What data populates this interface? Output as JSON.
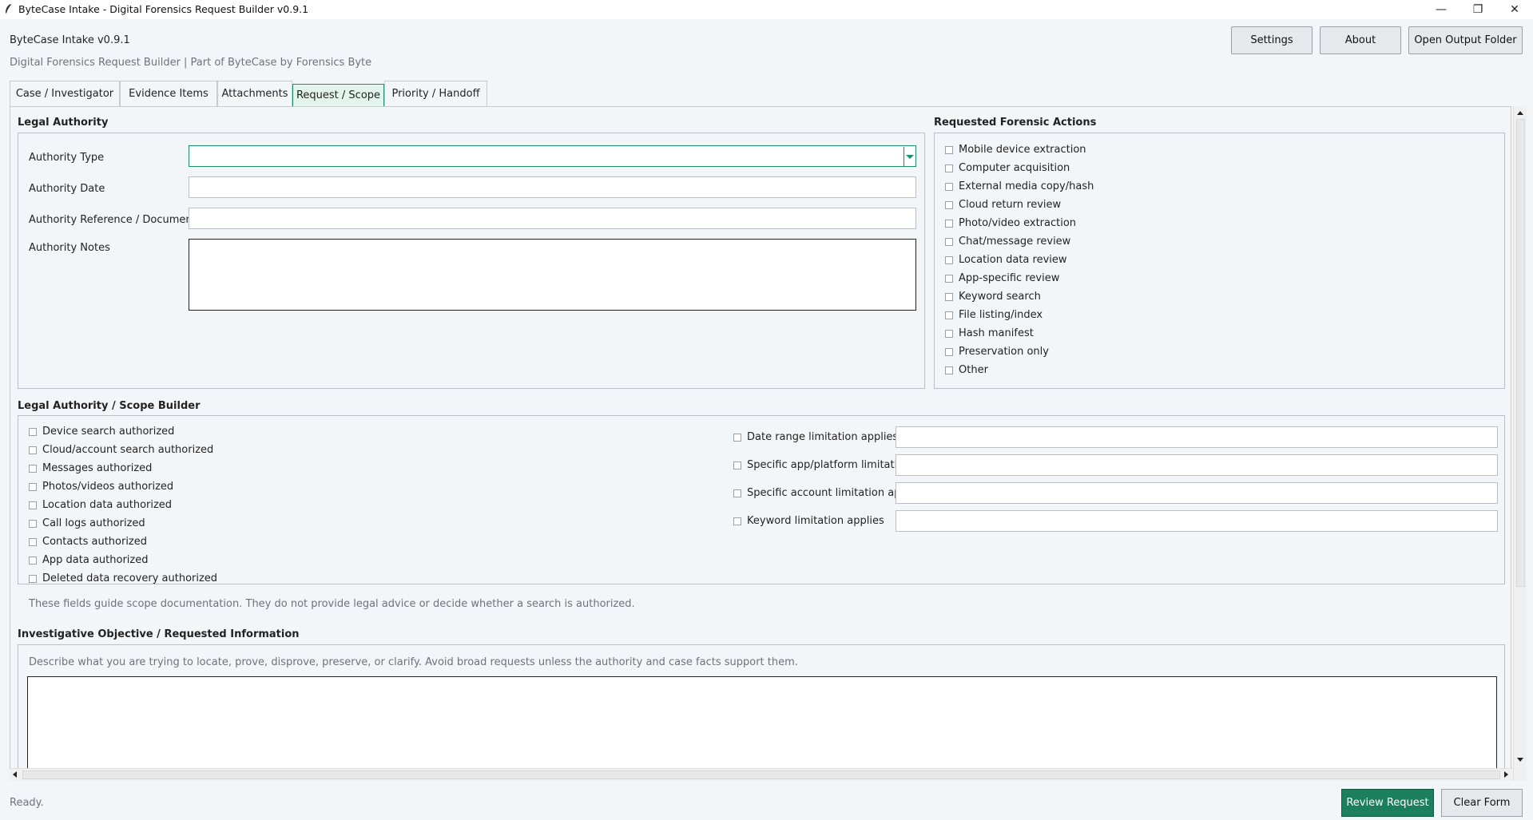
{
  "window": {
    "title": "ByteCase Intake - Digital Forensics Request Builder v0.9.1",
    "controls": {
      "minimize": "—",
      "restore": "❐",
      "close": "✕"
    }
  },
  "header": {
    "app_title": "ByteCase Intake v0.9.1",
    "subtitle": "Digital Forensics Request Builder | Part of ByteCase by Forensics Byte",
    "buttons": {
      "settings": "Settings",
      "about": "About",
      "open_output": "Open Output Folder"
    }
  },
  "tabs": [
    {
      "label": "Case / Investigator",
      "active": false
    },
    {
      "label": "Evidence Items",
      "active": false
    },
    {
      "label": "Attachments",
      "active": false
    },
    {
      "label": "Request / Scope",
      "active": true
    },
    {
      "label": "Priority / Handoff",
      "active": false
    }
  ],
  "legal_authority": {
    "title": "Legal Authority",
    "fields": {
      "type_label": "Authority Type",
      "type_value": "",
      "date_label": "Authority Date",
      "date_value": "",
      "ref_label": "Authority Reference / Document #",
      "ref_value": "",
      "notes_label": "Authority Notes",
      "notes_value": ""
    }
  },
  "forensic_actions": {
    "title": "Requested Forensic Actions",
    "items": [
      "Mobile device extraction",
      "Computer acquisition",
      "External media copy/hash",
      "Cloud return review",
      "Photo/video extraction",
      "Chat/message review",
      "Location data review",
      "App-specific review",
      "Keyword search",
      "File listing/index",
      "Hash manifest",
      "Preservation only",
      "Other"
    ]
  },
  "scope_builder": {
    "title": "Legal Authority / Scope Builder",
    "authorized": [
      "Device search authorized",
      "Cloud/account search authorized",
      "Messages authorized",
      "Photos/videos authorized",
      "Location data authorized",
      "Call logs authorized",
      "Contacts authorized",
      "App data authorized",
      "Deleted data recovery authorized"
    ],
    "limitations": [
      "Date range limitation applies",
      "Specific app/platform limitation applies",
      "Specific account limitation applies",
      "Keyword limitation applies"
    ],
    "note": "These fields guide scope documentation. They do not provide legal advice or decide whether a search is authorized."
  },
  "objective": {
    "title": "Investigative Objective / Requested Information",
    "hint": "Describe what you are trying to locate, prove, disprove, preserve, or clarify. Avoid broad requests unless the authority and case facts support them.",
    "value": ""
  },
  "footer": {
    "status": "Ready.",
    "review_button": "Review Request",
    "clear_button": "Clear Form"
  },
  "colors": {
    "accent": "#1b7f5e",
    "tab_active_bg": "#e3f4ec",
    "background": "#f3f6f9"
  }
}
